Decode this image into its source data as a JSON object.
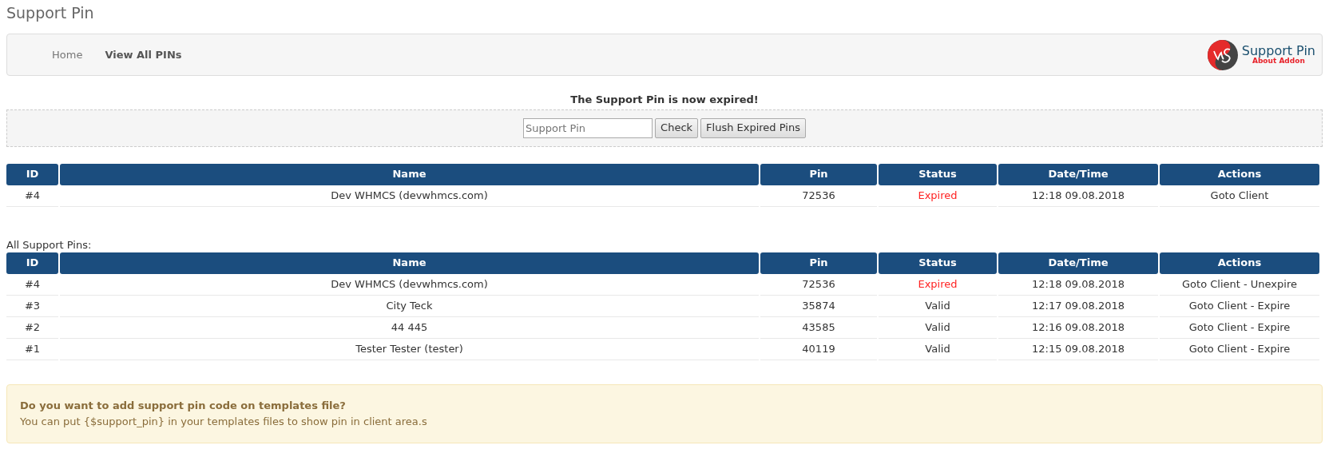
{
  "page_title": "Support Pin",
  "nav": {
    "items": [
      {
        "label": "Home",
        "selected": false
      },
      {
        "label": "View All PINs",
        "selected": true
      }
    ],
    "logo": {
      "title": "Support Pin",
      "subtitle": "About Addon"
    }
  },
  "check_form": {
    "message": "The Support Pin is now expired!",
    "placeholder": "Support Pin",
    "buttons": [
      "Check",
      "Flush Expired Pins"
    ]
  },
  "result_table": {
    "columns": [
      "ID",
      "Name",
      "Pin",
      "Status",
      "Date/Time",
      "Actions"
    ],
    "rows": [
      {
        "id": "#4",
        "name": "Dev WHMCS (devwhmcs.com)",
        "pin": "72536",
        "status": "Expired",
        "color": "#ff2222",
        "datetime": "12:18 09.08.2018",
        "actions": "Goto Client"
      }
    ]
  },
  "all_pins": {
    "heading": "All Support Pins:",
    "columns": [
      "ID",
      "Name",
      "Pin",
      "Status",
      "Date/Time",
      "Actions"
    ],
    "rows": [
      {
        "id": "#4",
        "name": "Dev WHMCS (devwhmcs.com)",
        "pin": "72536",
        "status": "Expired",
        "color": "#ff2222",
        "datetime": "12:18 09.08.2018",
        "actions": "Goto Client - Unexpire"
      },
      {
        "id": "#3",
        "name": "City Teck",
        "pin": "35874",
        "status": "Valid",
        "color": "#333333",
        "datetime": "12:17 09.08.2018",
        "actions": "Goto Client - Expire"
      },
      {
        "id": "#2",
        "name": "44 445",
        "pin": "43585",
        "status": "Valid",
        "color": "#333333",
        "datetime": "12:16 09.08.2018",
        "actions": "Goto Client - Expire"
      },
      {
        "id": "#1",
        "name": "Tester Tester (tester)",
        "pin": "40119",
        "status": "Valid",
        "color": "#333333",
        "datetime": "12:15 09.08.2018",
        "actions": "Goto Client - Expire"
      }
    ]
  },
  "notice": {
    "title": "Do you want to add support pin code on templates file?",
    "text": "You can put {$support_pin} in your templates files to show pin in client area.s"
  }
}
